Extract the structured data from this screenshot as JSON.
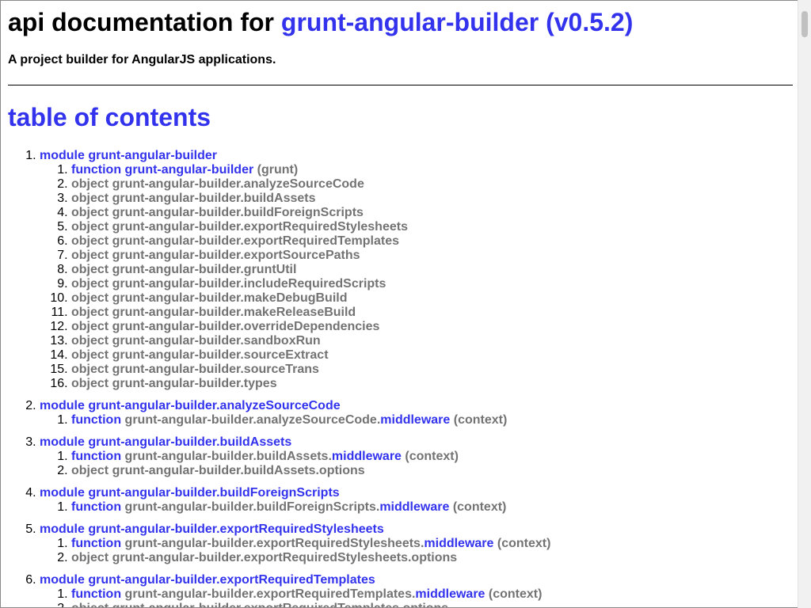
{
  "header": {
    "title_prefix": "api documentation for",
    "title_link": "grunt-angular-builder (v0.5.2)",
    "description": "A project builder for AngularJS applications."
  },
  "toc": {
    "heading": "table of contents",
    "modules": [
      {
        "label": "module grunt-angular-builder",
        "members": [
          {
            "kind": "function",
            "name": "grunt-angular-builder",
            "name_linked": true,
            "args": "(grunt)"
          },
          {
            "kind": "object",
            "name": "grunt-angular-builder.analyzeSourceCode"
          },
          {
            "kind": "object",
            "name": "grunt-angular-builder.buildAssets"
          },
          {
            "kind": "object",
            "name": "grunt-angular-builder.buildForeignScripts"
          },
          {
            "kind": "object",
            "name": "grunt-angular-builder.exportRequiredStylesheets"
          },
          {
            "kind": "object",
            "name": "grunt-angular-builder.exportRequiredTemplates"
          },
          {
            "kind": "object",
            "name": "grunt-angular-builder.exportSourcePaths"
          },
          {
            "kind": "object",
            "name": "grunt-angular-builder.gruntUtil"
          },
          {
            "kind": "object",
            "name": "grunt-angular-builder.includeRequiredScripts"
          },
          {
            "kind": "object",
            "name": "grunt-angular-builder.makeDebugBuild"
          },
          {
            "kind": "object",
            "name": "grunt-angular-builder.makeReleaseBuild"
          },
          {
            "kind": "object",
            "name": "grunt-angular-builder.overrideDependencies"
          },
          {
            "kind": "object",
            "name": "grunt-angular-builder.sandboxRun"
          },
          {
            "kind": "object",
            "name": "grunt-angular-builder.sourceExtract"
          },
          {
            "kind": "object",
            "name": "grunt-angular-builder.sourceTrans"
          },
          {
            "kind": "object",
            "name": "grunt-angular-builder.types"
          }
        ]
      },
      {
        "label": "module grunt-angular-builder.analyzeSourceCode",
        "members": [
          {
            "kind": "function",
            "prefix": "grunt-angular-builder.analyzeSourceCode.",
            "link": "middleware",
            "args": "(context)"
          }
        ]
      },
      {
        "label": "module grunt-angular-builder.buildAssets",
        "members": [
          {
            "kind": "function",
            "prefix": "grunt-angular-builder.buildAssets.",
            "link": "middleware",
            "args": "(context)"
          },
          {
            "kind": "object",
            "name": "grunt-angular-builder.buildAssets.options"
          }
        ]
      },
      {
        "label": "module grunt-angular-builder.buildForeignScripts",
        "members": [
          {
            "kind": "function",
            "prefix": "grunt-angular-builder.buildForeignScripts.",
            "link": "middleware",
            "args": "(context)"
          }
        ]
      },
      {
        "label": "module grunt-angular-builder.exportRequiredStylesheets",
        "members": [
          {
            "kind": "function",
            "prefix": "grunt-angular-builder.exportRequiredStylesheets.",
            "link": "middleware",
            "args": "(context)"
          },
          {
            "kind": "object",
            "name": "grunt-angular-builder.exportRequiredStylesheets.options"
          }
        ]
      },
      {
        "label": "module grunt-angular-builder.exportRequiredTemplates",
        "members": [
          {
            "kind": "function",
            "prefix": "grunt-angular-builder.exportRequiredTemplates.",
            "link": "middleware",
            "args": "(context)"
          },
          {
            "kind": "object",
            "name": "grunt-angular-builder.exportRequiredTemplates.options"
          }
        ]
      }
    ]
  }
}
